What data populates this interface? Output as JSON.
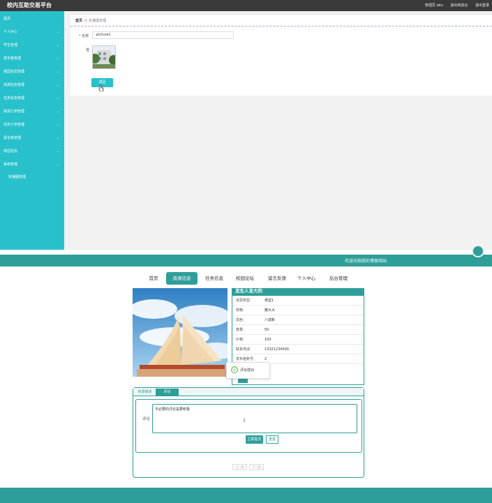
{
  "admin": {
    "title": "校内互助交易平台",
    "header_links": [
      "管理员 abo",
      "退出到前台",
      "退出登录"
    ],
    "sidebar": {
      "items": [
        {
          "label": "首页",
          "has_chevron": false
        },
        {
          "label": "个人中心",
          "has_chevron": true
        },
        {
          "label": "学生管理",
          "has_chevron": true
        },
        {
          "label": "发布者管理",
          "has_chevron": true
        },
        {
          "label": "校园信息管理",
          "has_chevron": true
        },
        {
          "label": "资源信息管理",
          "has_chevron": true
        },
        {
          "label": "任务信息管理",
          "has_chevron": true
        },
        {
          "label": "资源订单管理",
          "has_chevron": true
        },
        {
          "label": "任务订单管理",
          "has_chevron": true
        },
        {
          "label": "留言板管理",
          "has_chevron": true
        },
        {
          "label": "校园论坛",
          "has_chevron": true
        },
        {
          "label": "系统管理",
          "has_chevron": true
        }
      ],
      "sub_item": "轮播图管理"
    },
    "breadcrumb": {
      "home": "首页",
      "separator": "//",
      "current": "轮播图管理"
    },
    "form": {
      "name_label": "名称",
      "required_mark": "*",
      "name_value": "picture1",
      "image_label": "值",
      "back_button": "返回"
    }
  },
  "site": {
    "welcome": "欢迎光临我的博客网站",
    "nav": [
      {
        "label": "首页",
        "active": false
      },
      {
        "label": "资源信息",
        "active": true
      },
      {
        "label": "任务信息",
        "active": false
      },
      {
        "label": "校园论坛",
        "active": false
      },
      {
        "label": "留言反馈",
        "active": false
      },
      {
        "label": "个人中心",
        "active": false
      },
      {
        "label": "后台管理",
        "active": false
      }
    ],
    "resource": {
      "title": "发生人发大的",
      "fields": [
        {
          "key": "资源类型：",
          "value": "类型1"
        },
        {
          "key": "规格：",
          "value": "撒大大"
        },
        {
          "key": "成色：",
          "value": "八成新"
        },
        {
          "key": "数量：",
          "value": "50"
        },
        {
          "key": "价格：",
          "value": "100"
        },
        {
          "key": "联系电话：",
          "value": "13321234500"
        },
        {
          "key": "发布者账号：",
          "value": "2"
        }
      ]
    },
    "toast": "评论成功",
    "tabs": {
      "desc": "资源描述",
      "comment": "评论"
    },
    "comment": {
      "label": "评论",
      "text": "不必要的评论是要积极",
      "submit": "立即提交",
      "reset": "重置"
    },
    "pager": {
      "prev": "上一页",
      "next": "下一页"
    },
    "colors": {
      "sidebar": "#28c1cb",
      "site_accent": "#2e9e99",
      "header": "#3a3a3a"
    }
  }
}
